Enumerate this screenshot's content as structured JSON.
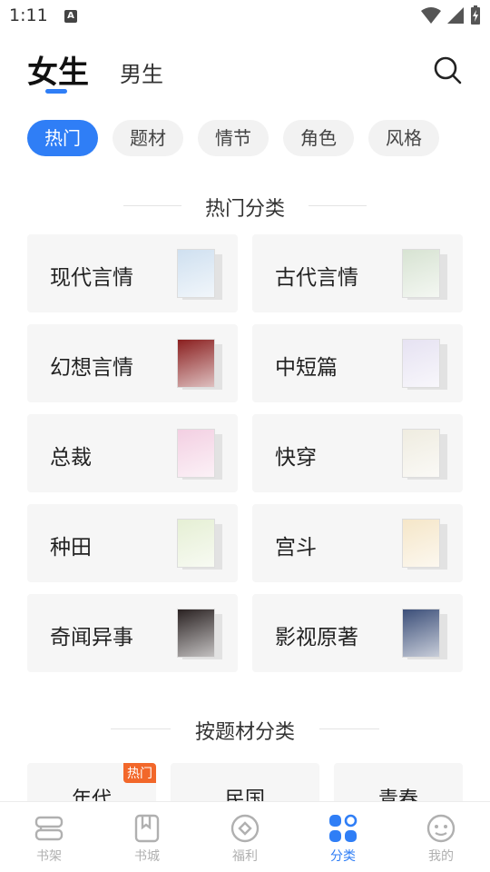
{
  "status_bar": {
    "time": "1:11",
    "notification_letter": "A"
  },
  "header": {
    "tabs": [
      {
        "label": "女生",
        "active": true
      },
      {
        "label": "男生",
        "active": false
      }
    ],
    "search_icon": "search-icon"
  },
  "filter_chips": [
    {
      "label": "热门",
      "active": true
    },
    {
      "label": "题材",
      "active": false
    },
    {
      "label": "情节",
      "active": false
    },
    {
      "label": "角色",
      "active": false
    },
    {
      "label": "风格",
      "active": false
    }
  ],
  "hot_section": {
    "title": "热门分类",
    "categories": [
      {
        "label": "现代言情",
        "cover_color": "#cfe0f0"
      },
      {
        "label": "古代言情",
        "cover_color": "#d7e3d2"
      },
      {
        "label": "幻想言情",
        "cover_color": "#8a1f1f"
      },
      {
        "label": "中短篇",
        "cover_color": "#e6e2f2"
      },
      {
        "label": "总裁",
        "cover_color": "#f3cfe2"
      },
      {
        "label": "快穿",
        "cover_color": "#efece0"
      },
      {
        "label": "种田",
        "cover_color": "#e5efd4"
      },
      {
        "label": "宫斗",
        "cover_color": "#f5e6c8"
      },
      {
        "label": "奇闻异事",
        "cover_color": "#2a2222"
      },
      {
        "label": "影视原著",
        "cover_color": "#3c4f79"
      }
    ]
  },
  "theme_section": {
    "title": "按题材分类",
    "items": [
      {
        "label": "年代",
        "tag": "热门"
      },
      {
        "label": "民国",
        "tag": ""
      },
      {
        "label": "青春",
        "tag": ""
      }
    ]
  },
  "bottom_nav": [
    {
      "label": "书架",
      "icon": "bookshelf-icon",
      "active": false
    },
    {
      "label": "书城",
      "icon": "bookstore-icon",
      "active": false
    },
    {
      "label": "福利",
      "icon": "benefits-icon",
      "active": false
    },
    {
      "label": "分类",
      "icon": "category-icon",
      "active": true
    },
    {
      "label": "我的",
      "icon": "profile-icon",
      "active": false
    }
  ],
  "colors": {
    "accent": "#2f7ef6",
    "hot_tag": "#f2672a",
    "card_bg": "#f6f6f6"
  }
}
